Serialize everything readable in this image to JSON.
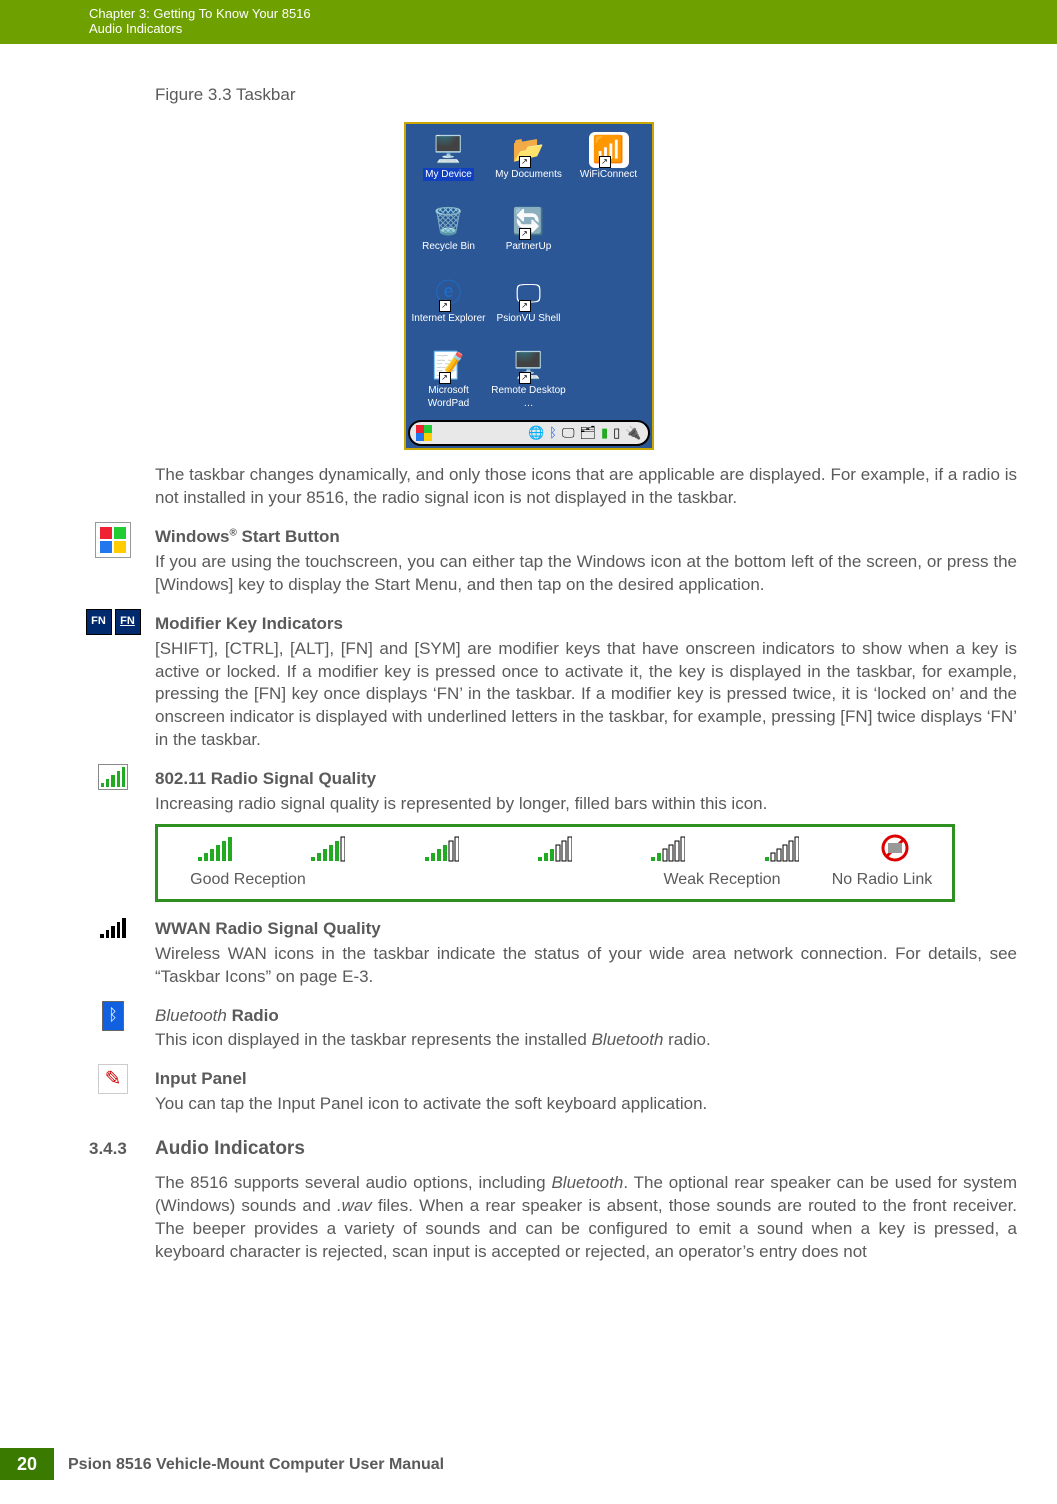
{
  "header": {
    "line1": "Chapter 3:  Getting To Know Your 8516",
    "line2": "Audio Indicators"
  },
  "figure": {
    "caption": "Figure 3.3    Taskbar"
  },
  "screenshot": {
    "icons": [
      {
        "label": "My Device"
      },
      {
        "label": "My Documents"
      },
      {
        "label": "WiFiConnect"
      },
      {
        "label": "Recycle Bin"
      },
      {
        "label": "PartnerUp"
      },
      {
        "label": ""
      },
      {
        "label": "Internet Explorer"
      },
      {
        "label": "PsionVU Shell"
      },
      {
        "label": ""
      },
      {
        "label": "Microsoft WordPad"
      },
      {
        "label": "Remote Desktop …"
      },
      {
        "label": ""
      }
    ]
  },
  "intro": "The taskbar changes dynamically, and only those icons that are applicable are displayed. For example, if a radio is not installed in your 8516, the radio signal icon is not displayed in the taskbar.",
  "windows": {
    "title_pre": "Windows",
    "title_sup": "®",
    "title_post": " Start Button",
    "body": "If you are using the touchscreen, you can either tap the Windows icon at the bottom left of the screen, or press the [Windows] key to display the Start Menu, and then tap on the desired application."
  },
  "modifier": {
    "title": "Modifier Key Indicators",
    "body": "[SHIFT], [CTRL], [ALT], [FN] and [SYM] are modifier keys that have onscreen indicators to show when a key is active or locked. If a modifier key is pressed once to activate it, the key is displayed in the taskbar, for example, pressing the [FN] key once displays ‘FN’ in the taskbar. If a modifier key is pressed twice, it is ‘locked on’ and the onscreen indicator is displayed with underlined letters in the taskbar, for example, pressing [FN] twice displays ‘FN’ in the taskbar.",
    "fn": "FN"
  },
  "radio": {
    "title": "802.11 Radio Signal Quality",
    "body": "Increasing radio signal quality is represented by longer, filled bars within this icon.",
    "labels": {
      "good": "Good Reception",
      "weak": "Weak Reception",
      "none": "No Radio Link"
    }
  },
  "wwan": {
    "title": "WWAN Radio Signal Quality",
    "body": "Wireless WAN icons in the taskbar indicate the status of your wide area network connection. For details, see “Taskbar Icons” on page E-3."
  },
  "bt": {
    "title_pre": "Bluetooth",
    "title_post": " Radio",
    "body_pre": "This icon displayed in the taskbar represents the installed ",
    "body_em": "Bluetooth",
    "body_post": " radio."
  },
  "input": {
    "title": "Input Panel",
    "body": "You can tap the Input Panel icon to activate the soft keyboard application."
  },
  "section": {
    "number": "3.4.3",
    "title": "Audio Indicators",
    "body_pre": "The 8516 supports several audio options, including ",
    "body_em1": "Bluetooth",
    "body_mid": ". The optional rear speaker can be used for system (Windows) sounds and ",
    "body_em2": ".wav",
    "body_post": " files. When a rear speaker is absent, those sounds are routed to the front receiver. The beeper provides a variety of sounds and can be configured to emit a sound when a key is pressed, a keyboard character is rejected, scan input is accepted or rejected, an operator’s entry does not"
  },
  "footer": {
    "page": "20",
    "title": "Psion 8516 Vehicle-Mount Computer User Manual"
  }
}
